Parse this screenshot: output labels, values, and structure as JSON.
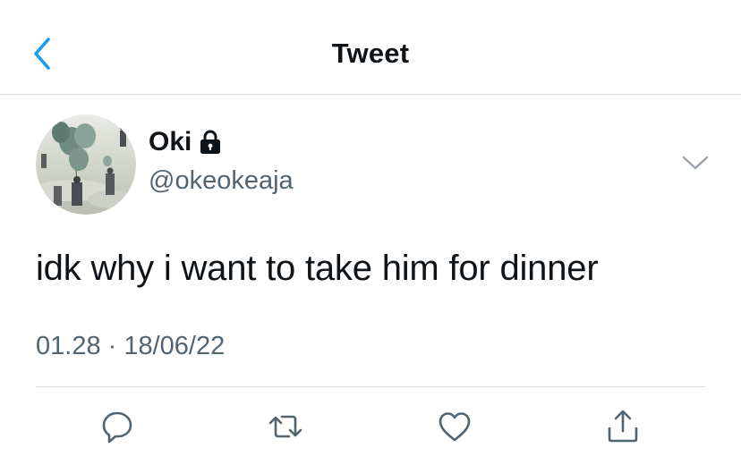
{
  "header": {
    "title": "Tweet"
  },
  "author": {
    "name": "Oki",
    "handle": "@okeokeaja",
    "protected": true
  },
  "tweet": {
    "text": "idk why i want to take him for dinner",
    "timestamp": "01.28 · 18/06/22"
  },
  "actions": [
    "reply-icon",
    "retweet-icon",
    "like-icon",
    "share-icon"
  ],
  "colors": {
    "accent": "#1d9bf0",
    "secondary_text": "#536471",
    "divider": "#d9dde1"
  }
}
